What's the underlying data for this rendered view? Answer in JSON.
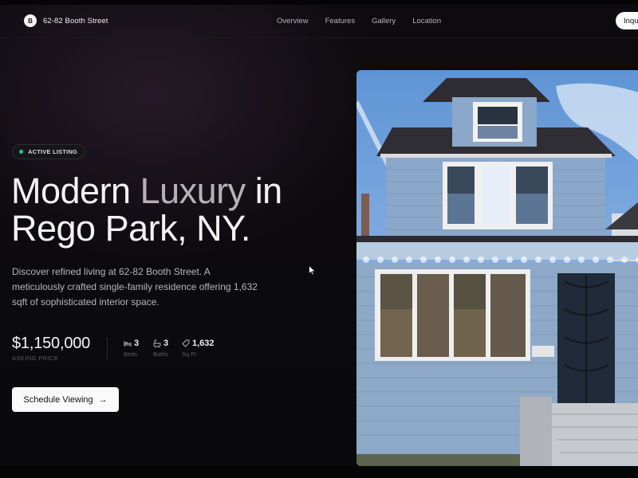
{
  "nav": {
    "brand_initial": "B",
    "brand_name": "62-82 Booth Street",
    "links": [
      "Overview",
      "Features",
      "Gallery",
      "Location"
    ],
    "cta_label": "Inqu"
  },
  "hero": {
    "badge": "ACTIVE LISTING",
    "headline_part1": "Modern",
    "headline_part2": "Luxury",
    "headline_part3": "in",
    "headline_line2": "Rego Park, NY.",
    "description": "Discover refined living at 62-82 Booth Street. A meticulously crafted single-family residence offering 1,632 sqft of sophisticated interior space.",
    "price": "$1,150,000",
    "price_label": "ASKING PRICE",
    "stats": [
      {
        "icon": "bed-icon",
        "value": "3",
        "label": "Beds"
      },
      {
        "icon": "bath-icon",
        "value": "3",
        "label": "Baths"
      },
      {
        "icon": "tag-icon",
        "value": "1,632",
        "label": "Sq Ft"
      }
    ],
    "cta_label": "Schedule Viewing",
    "cta_icon": "arrow-right-icon"
  },
  "colors": {
    "background": "#0b0a0c",
    "badge_dot": "#23c38a",
    "button_bg": "#fafafa"
  }
}
